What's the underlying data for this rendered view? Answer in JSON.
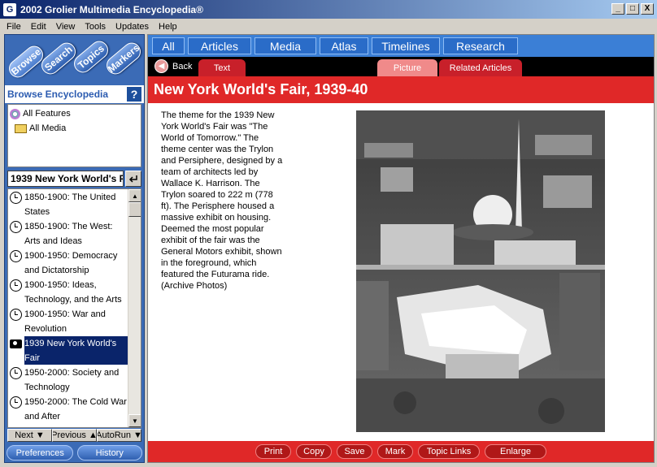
{
  "window": {
    "title": "2002 Grolier Multimedia Encyclopedia®",
    "app_icon": "G",
    "controls": [
      "_",
      "□",
      "X"
    ]
  },
  "menu": [
    "File",
    "Edit",
    "View",
    "Tools",
    "Updates",
    "Help"
  ],
  "sidebar": {
    "nav_tabs": [
      "Browse",
      "Search",
      "Topics",
      "Markers"
    ],
    "header": "Browse Encyclopedia",
    "help_label": "?",
    "tree": [
      "All Features",
      "All Media"
    ],
    "search_value": "1939 New York World's F",
    "list": [
      {
        "icon": "clock-icon",
        "text": "1850-1900: The United States"
      },
      {
        "icon": "clock-icon",
        "text": "1850-1900: The West: Arts and Ideas"
      },
      {
        "icon": "clock-icon",
        "text": "1900-1950: Democracy and Dictatorship"
      },
      {
        "icon": "clock-icon",
        "text": "1900-1950: Ideas, Technology, and the Arts"
      },
      {
        "icon": "clock-icon",
        "text": "1900-1950: War and Revolution"
      },
      {
        "icon": "camera-icon",
        "text": "1939 New York World's Fair",
        "selected": true
      },
      {
        "icon": "clock-icon",
        "text": "1950-2000: Society and Technology"
      },
      {
        "icon": "clock-icon",
        "text": "1950-2000: The Cold War and After"
      }
    ],
    "pager": [
      "Next ▼",
      "Previous ▲",
      "AutoRun ▼"
    ],
    "bottom_buttons": [
      "Preferences",
      "History"
    ]
  },
  "main": {
    "top_nav": [
      "All",
      "Articles",
      "Media",
      "Atlas",
      "Timelines",
      "Research"
    ],
    "back_label": "Back",
    "text_tab": "Text",
    "picture_tab": "Picture",
    "related_tab": "Related Articles",
    "article_title": "New York World's Fair, 1939-40",
    "caption": "The theme for the 1939 New York World's Fair was \"The World of Tomorrow.\" The theme center was the Trylon and Persiphere, designed by a team of architects led by Wallace K. Harrison. The Trylon soared to 222 m (778 ft). The Perisphere housed a massive exhibit on housing. Deemed the most popular exhibit of the fair was the General Motors exhibit, shown in the foreground, which featured the Futurama ride. (Archive Photos)",
    "actions": [
      "Print",
      "Copy",
      "Save",
      "Mark",
      "Topic Links",
      "Enlarge"
    ]
  }
}
